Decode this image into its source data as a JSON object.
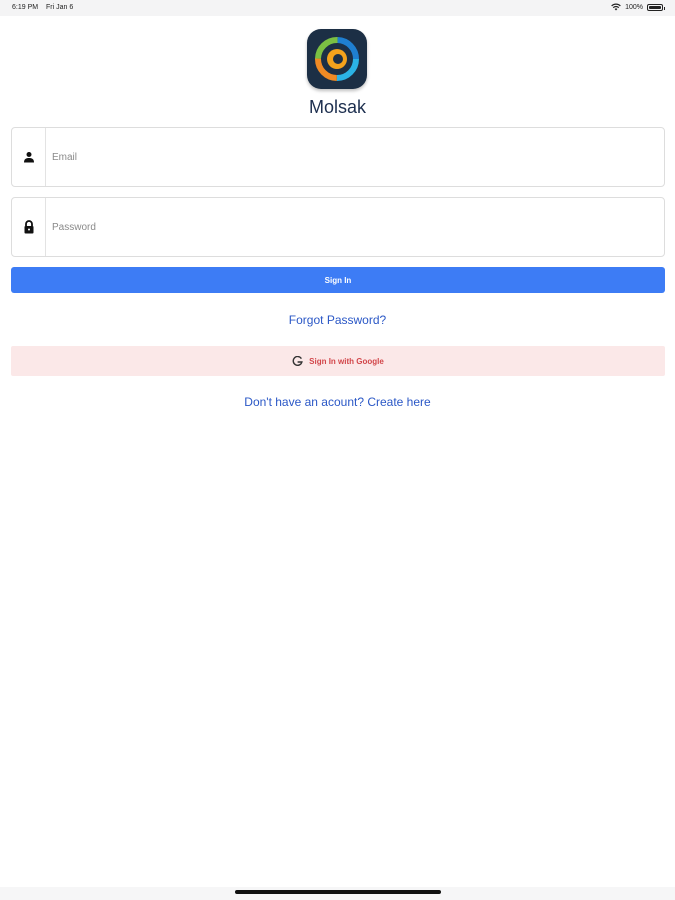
{
  "status_bar": {
    "time": "6:19 PM",
    "date": "Fri Jan 6",
    "battery": "100%",
    "icons": [
      "wifi-icon",
      "battery-icon"
    ]
  },
  "app": {
    "name": "Molsak",
    "icon": "molsak-logo-icon"
  },
  "form": {
    "email": {
      "placeholder": "Email",
      "value": "",
      "icon": "person-icon"
    },
    "password": {
      "placeholder": "Password",
      "value": "",
      "icon": "lock-icon"
    },
    "sign_in_label": "Sign In",
    "forgot_password_label": "Forgot Password?",
    "google_label": "Sign In with Google",
    "google_icon": "google-icon",
    "create_account_label": "Don't have an acount? Create here"
  },
  "colors": {
    "primary": "#3d7cf5",
    "link": "#2a57c6",
    "google_bg": "#fbe8e8",
    "google_text": "#d2464a",
    "app_name": "#1d2f4f"
  }
}
